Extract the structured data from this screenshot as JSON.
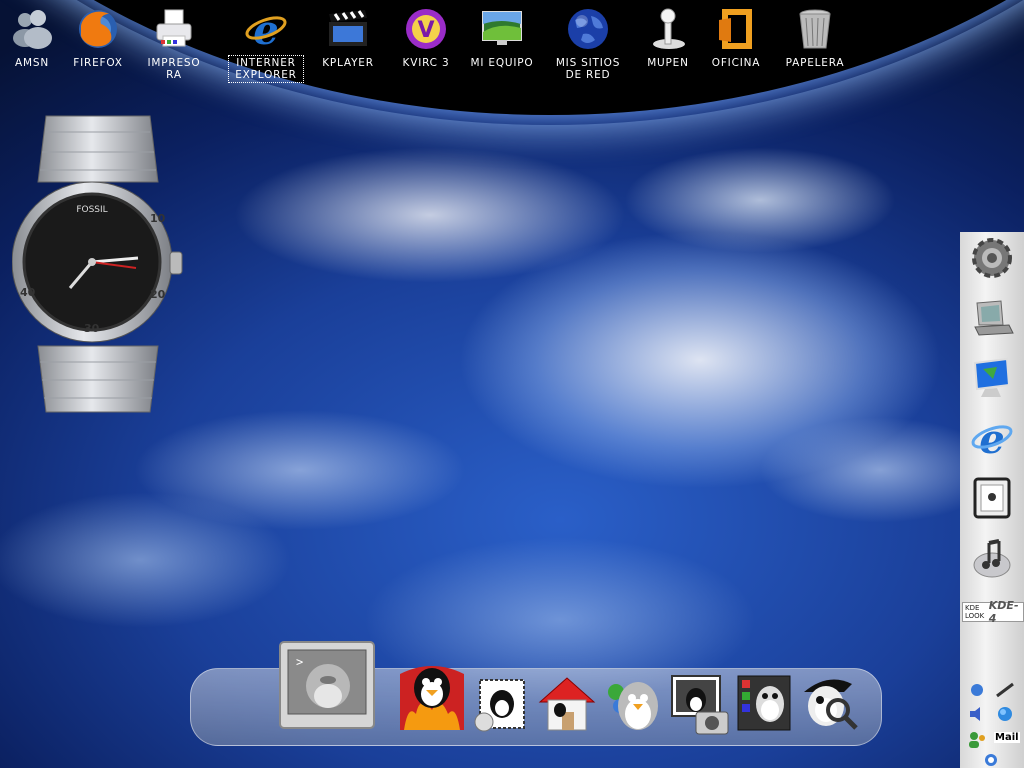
{
  "desktop_icons": [
    {
      "label": "AMSN",
      "icon": "amsn-buddy-icon"
    },
    {
      "label": "FIREFOX",
      "icon": "firefox-icon"
    },
    {
      "label": "IMPRESO\nRA",
      "icon": "printer-icon"
    },
    {
      "label": "INTERNER\nEXPLORER",
      "icon": "internet-explorer-icon"
    },
    {
      "label": "KPLAYER",
      "icon": "clapperboard-icon"
    },
    {
      "label": "KVIRC 3",
      "icon": "kvirc-icon"
    },
    {
      "label": "MI EQUIPO",
      "icon": "my-computer-icon"
    },
    {
      "label": "MIS SITIOS\nDE RED",
      "icon": "globe-icon"
    },
    {
      "label": "MUPEN",
      "icon": "joystick-icon"
    },
    {
      "label": "OFICINA",
      "icon": "office-icon"
    },
    {
      "label": "PAPELERA",
      "icon": "trash-icon"
    }
  ],
  "watch": {
    "brand": "FOSSIL",
    "dial_numbers": [
      "10",
      "20",
      "30",
      "40"
    ]
  },
  "side_panel": {
    "items": [
      "gear-icon",
      "laptop-icon",
      "monitor-icon",
      "internet-explorer-icon",
      "mac-tower-icon",
      "music-icon"
    ],
    "kde_badge": {
      "left": "KDE LOOK",
      "right": "KDE-4"
    },
    "tray": {
      "mail_label": "Mail"
    }
  },
  "dock": {
    "items": [
      "terminal-penguin-icon",
      "fire-penguin-icon",
      "mail-penguin-icon",
      "home-icon",
      "messenger-penguin-icon",
      "camera-penguin-icon",
      "control-panel-penguin-icon",
      "search-penguin-icon"
    ]
  },
  "colors": {
    "wallpaper_blue": "#1a3f99",
    "panel_gray": "#e6e6e6",
    "label_white": "#ffffff"
  }
}
